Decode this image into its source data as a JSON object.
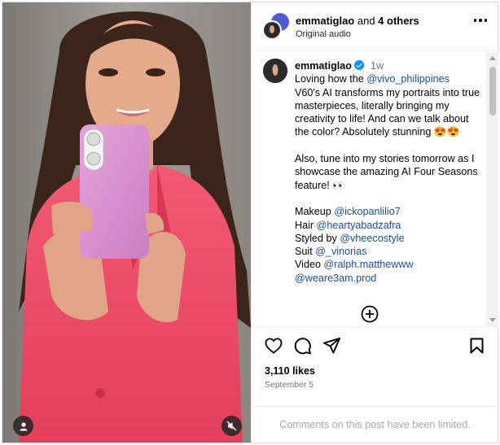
{
  "header": {
    "username": "emmatiglao",
    "others_text": " and ",
    "others_count": "4 others",
    "audio": "Original audio"
  },
  "caption": {
    "username": "emmatiglao",
    "time": "1w",
    "line1_pre": "Loving how the ",
    "mention_vivo": "@vivo_philippines",
    "line2": "V60's AI transforms my portraits into true masterpieces, literally bringing my creativity to life! And can we talk about the color? Absolutely stunning 😍😍",
    "para2": "Also, tune into my stories tomorrow as I showcase the amazing AI Four Seasons feature! 👀",
    "credits": [
      {
        "label": "Makeup ",
        "handle": "@ickopanlilio7"
      },
      {
        "label": "Hair ",
        "handle": "@heartyabadzafra"
      },
      {
        "label": "Styled by ",
        "handle": "@vheecostyle"
      },
      {
        "label": "Suit ",
        "handle": "@_vinorias"
      },
      {
        "label": "Video ",
        "handle": "@ralph.matthewww"
      },
      {
        "label": "",
        "handle": "@weare3am.prod"
      }
    ]
  },
  "stats": {
    "likes": "3,110 likes",
    "date": "September 5"
  },
  "comments_limited": "Comments on this post have been limited.",
  "icons": {
    "like": "heart-icon",
    "comment": "comment-icon",
    "share": "share-icon",
    "save": "bookmark-icon",
    "more": "more-options-icon",
    "add": "add-comment-icon",
    "user": "user-tag-icon",
    "mute": "muted-speaker-icon"
  },
  "colors": {
    "mention": "#1a4e96",
    "verified": "#0095f6",
    "muted_text": "#737373",
    "blazer": "#ee4a64",
    "phone": "#d98fcf"
  }
}
